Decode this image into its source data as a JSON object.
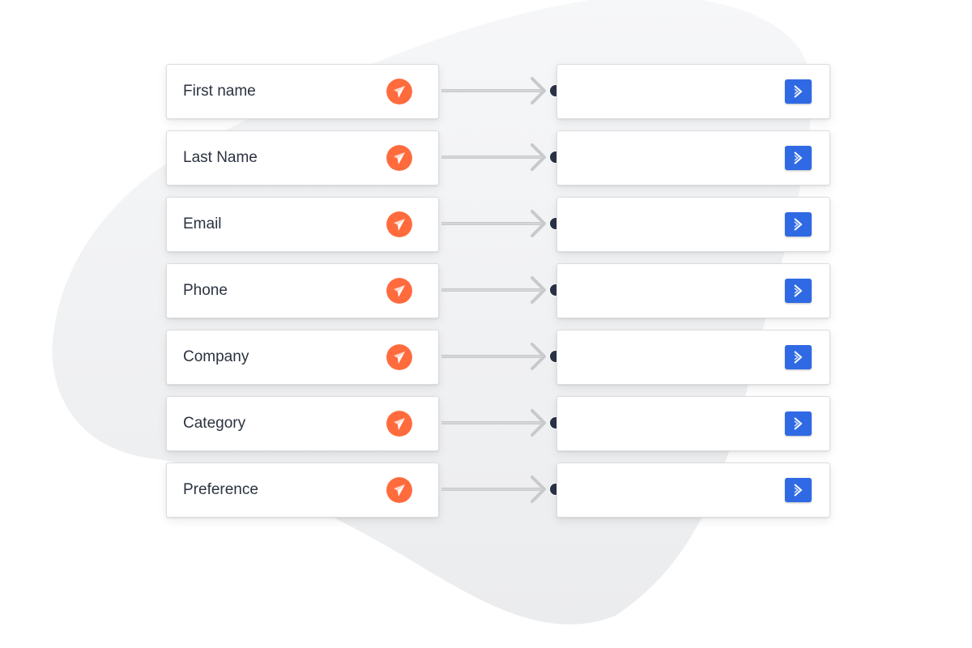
{
  "colors": {
    "source_icon": "#ff6b3d",
    "target_icon": "#2f6ae4",
    "connector_dot": "#2a3347",
    "arrow": "#c8c9cc",
    "background_blob": "#eeeff1"
  },
  "icons": {
    "source": "paper-plane-icon",
    "target": "chevron-right-icon"
  },
  "mappings": [
    {
      "source": "First name",
      "target": ""
    },
    {
      "source": "Last Name",
      "target": ""
    },
    {
      "source": "Email",
      "target": ""
    },
    {
      "source": "Phone",
      "target": ""
    },
    {
      "source": "Company",
      "target": ""
    },
    {
      "source": "Category",
      "target": ""
    },
    {
      "source": "Preference",
      "target": ""
    }
  ]
}
